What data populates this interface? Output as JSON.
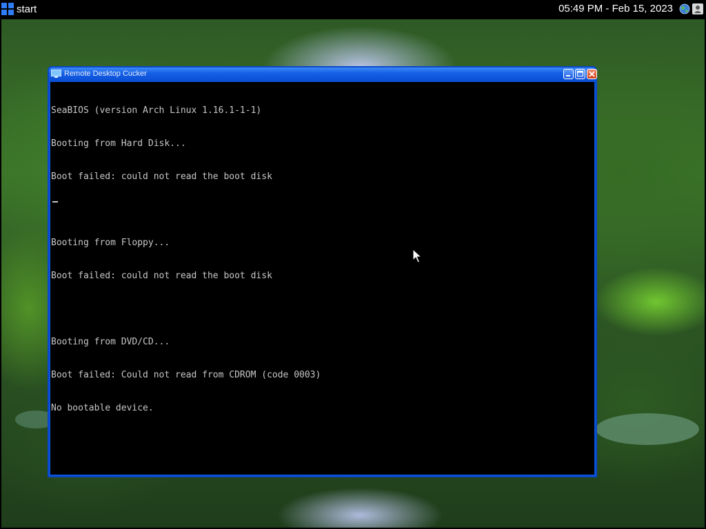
{
  "taskbar": {
    "start_label": "start",
    "clock": "05:49 PM - Feb 15, 2023",
    "icons": [
      "windows-logo-icon",
      "globe-icon",
      "user-icon"
    ]
  },
  "window": {
    "title": "Remote Desktop Cucker",
    "buttons": [
      "minimize",
      "maximize",
      "close"
    ],
    "console_lines": [
      "SeaBIOS (version Arch Linux 1.16.1-1-1)",
      "Booting from Hard Disk...",
      "Boot failed: could not read the boot disk",
      "",
      "Booting from Floppy...",
      "Boot failed: could not read the boot disk",
      "",
      "Booting from DVD/CD...",
      "Boot failed: Could not read from CDROM (code 0003)",
      "No bootable device."
    ]
  },
  "colors": {
    "taskbar_bg": "#000000",
    "titlebar_blue": "#1560e6",
    "console_bg": "#000000",
    "console_text": "#c8c8c8",
    "close_red": "#d2401a"
  }
}
